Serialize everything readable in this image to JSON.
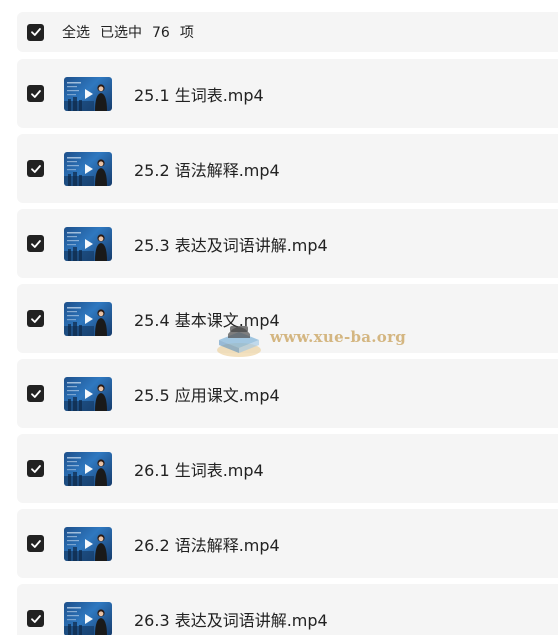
{
  "select_all": {
    "checked": true,
    "label": "全选",
    "selected_prefix": "已选中",
    "selected_count": "76",
    "selected_suffix": "项"
  },
  "files": [
    {
      "name": "25.1 生词表.mp4",
      "checked": true
    },
    {
      "name": "25.2 语法解释.mp4",
      "checked": true
    },
    {
      "name": "25.3 表达及词语讲解.mp4",
      "checked": true
    },
    {
      "name": "25.4 基本课文.mp4",
      "checked": true
    },
    {
      "name": "25.5 应用课文.mp4",
      "checked": true
    },
    {
      "name": "26.1 生词表.mp4",
      "checked": true
    },
    {
      "name": "26.2 语法解释.mp4",
      "checked": true
    },
    {
      "name": "26.3 表达及词语讲解.mp4",
      "checked": true
    }
  ],
  "watermark": {
    "text": "www.xue-ba.org"
  },
  "colors": {
    "row_background": "#f5f5f5",
    "checkbox": "#222222",
    "text": "#222222",
    "thumbnail": "#2f78c0"
  }
}
